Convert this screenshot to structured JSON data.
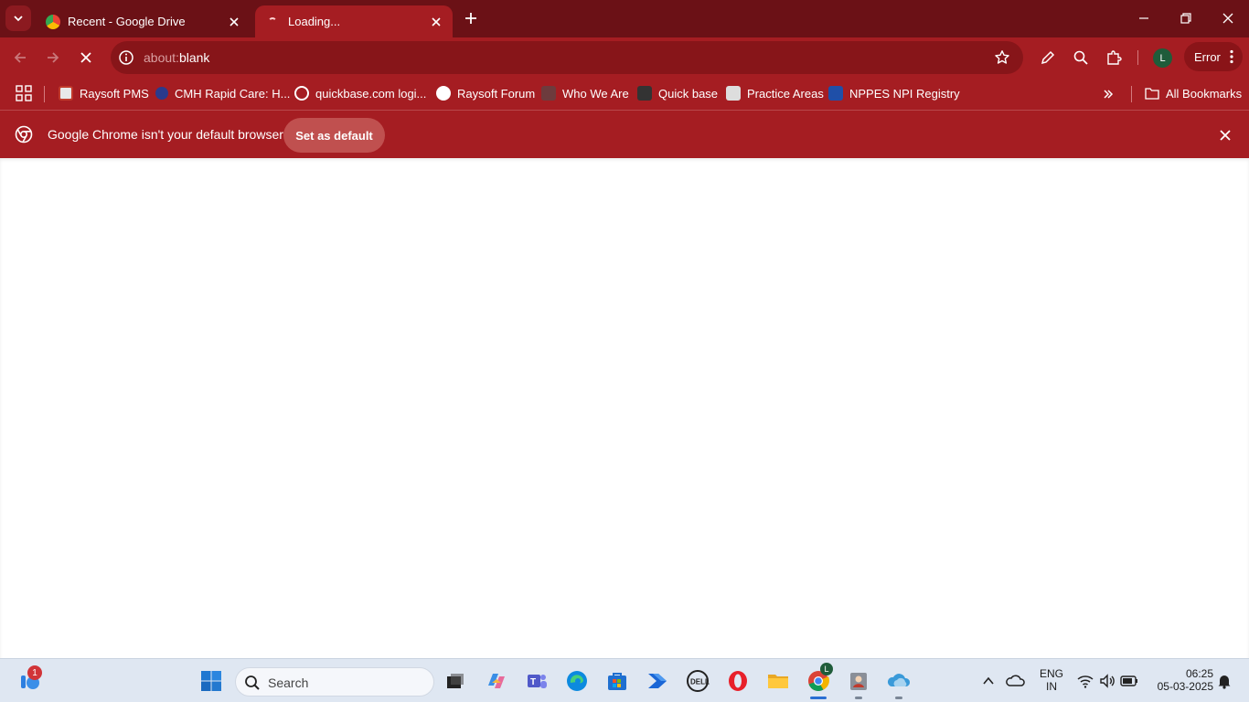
{
  "tabs": [
    {
      "title": "Recent - Google Drive",
      "active": false
    },
    {
      "title": "Loading...",
      "active": true
    }
  ],
  "omnibox": {
    "scheme": "about:",
    "rest": "blank"
  },
  "profile": {
    "initial": "L",
    "status": "Error"
  },
  "bookmarks": [
    {
      "label": "Raysoft PMS",
      "color": "#c0392b"
    },
    {
      "label": "CMH Rapid Care: H...",
      "color": "#2b3a8c"
    },
    {
      "label": "quickbase.com logi...",
      "color": "#ffffff"
    },
    {
      "label": "Raysoft Forum",
      "color": "#ffffff"
    },
    {
      "label": "Who We Are",
      "color": "#444444"
    },
    {
      "label": "Quick base",
      "color": "#333333"
    },
    {
      "label": "Practice Areas",
      "color": "#dddddd"
    },
    {
      "label": "NPPES NPI Registry",
      "color": "#1f4fa8"
    }
  ],
  "all_bookmarks": "All Bookmarks",
  "infobar": {
    "message": "Google Chrome isn't your default browser",
    "button": "Set as default"
  },
  "taskbar": {
    "search_placeholder": "Search",
    "widget_badge": "1",
    "chrome_badge": "L",
    "language": "ENG",
    "region": "IN",
    "time": "06:25",
    "date": "05-03-2025"
  },
  "colors": {
    "frame": "#6b1116",
    "toolbar": "#a51d22",
    "omnibox": "#871519"
  }
}
